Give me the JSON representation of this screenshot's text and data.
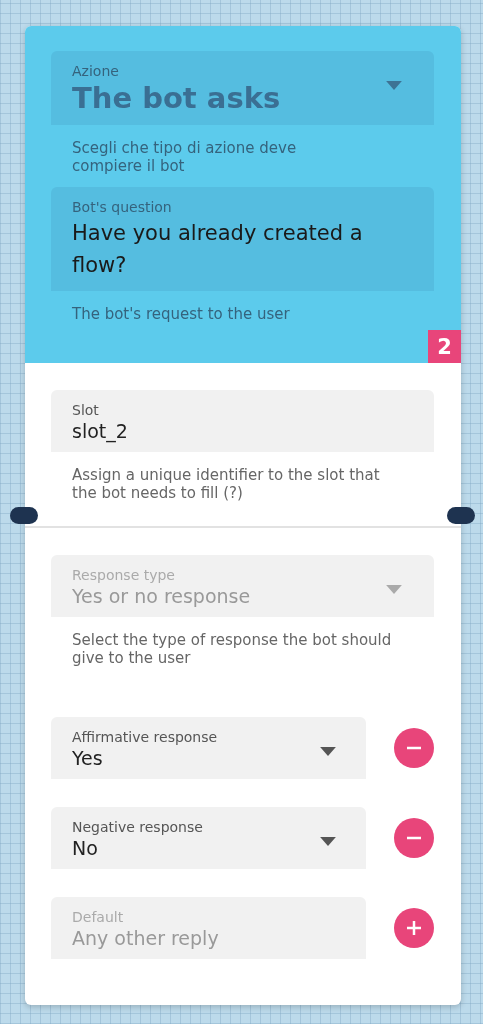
{
  "action_field": {
    "label": "Azione",
    "value": "The bot asks",
    "helper": "Scegli che tipo di azione deve compiere il bot"
  },
  "question_field": {
    "label": "Bot's question",
    "value": "Have you already created a flow?",
    "helper": "The bot's request to the user"
  },
  "node_badge": "2",
  "slot_field": {
    "label": "Slot",
    "value": "slot_2",
    "helper": "Assign a unique identifier to the slot that the bot needs to fill (?)"
  },
  "response_type_field": {
    "label": "Response type",
    "value": "Yes or no response",
    "disabled": true,
    "helper": "Select the type of response the bot should give to the user"
  },
  "responses": [
    {
      "kind": "select",
      "label": "Affirmative response",
      "value": "Yes",
      "removable": true
    },
    {
      "kind": "select",
      "label": "Negative response",
      "value": "No",
      "removable": true
    },
    {
      "kind": "text",
      "label": "Default",
      "placeholder": "Any other reply",
      "removable": false
    }
  ]
}
